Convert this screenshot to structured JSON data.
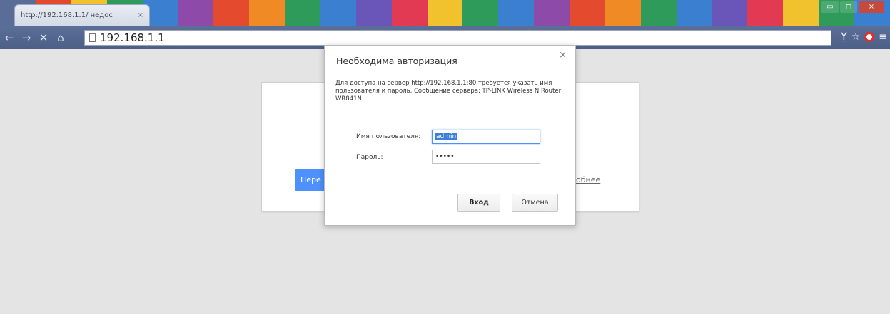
{
  "browser": {
    "tab_title": "http://192.168.1.1/ недос",
    "tab_close": "×",
    "address": "192.168.1.1",
    "window_buttons": {
      "minimize": "▭",
      "maximize": "◻",
      "close": "×"
    },
    "nav_icons": {
      "back": "←",
      "forward": "→",
      "stop": "✕",
      "home": "⌂"
    },
    "tool_icons": {
      "filter": "Ỵ",
      "bookmark_star": "☆",
      "menu": "≡"
    },
    "stripe_colors": [
      "#5a6d96",
      "#e44a2e",
      "#f2c12e",
      "#2e9b5a",
      "#3a7fd0",
      "#8e4aa8",
      "#e44a2e",
      "#f08a24",
      "#2e9b5a",
      "#3a7fd0",
      "#6a55b8",
      "#e23a52",
      "#f2c12e",
      "#2e9b5a",
      "#3a7fd0",
      "#8e4aa8",
      "#e44a2e",
      "#f08a24",
      "#2e9b5a",
      "#3a7fd0",
      "#6a55b8",
      "#e23a52",
      "#f2c12e",
      "#2e9b5a",
      "#3a7fd0"
    ]
  },
  "error_page": {
    "reload_label": "Пере",
    "more_link": "робнее"
  },
  "dialog": {
    "title": "Необходима авторизация",
    "close": "×",
    "message": "Для доступа на сервер http://192.168.1.1:80 требуется указать имя пользователя и пароль. Сообщение сервера: TP-LINK Wireless N Router WR841N.",
    "username_label": "Имя пользователя:",
    "username_value": "admin",
    "password_label": "Пароль:",
    "password_value": "•••••",
    "login_button": "Вход",
    "cancel_button": "Отмена"
  }
}
